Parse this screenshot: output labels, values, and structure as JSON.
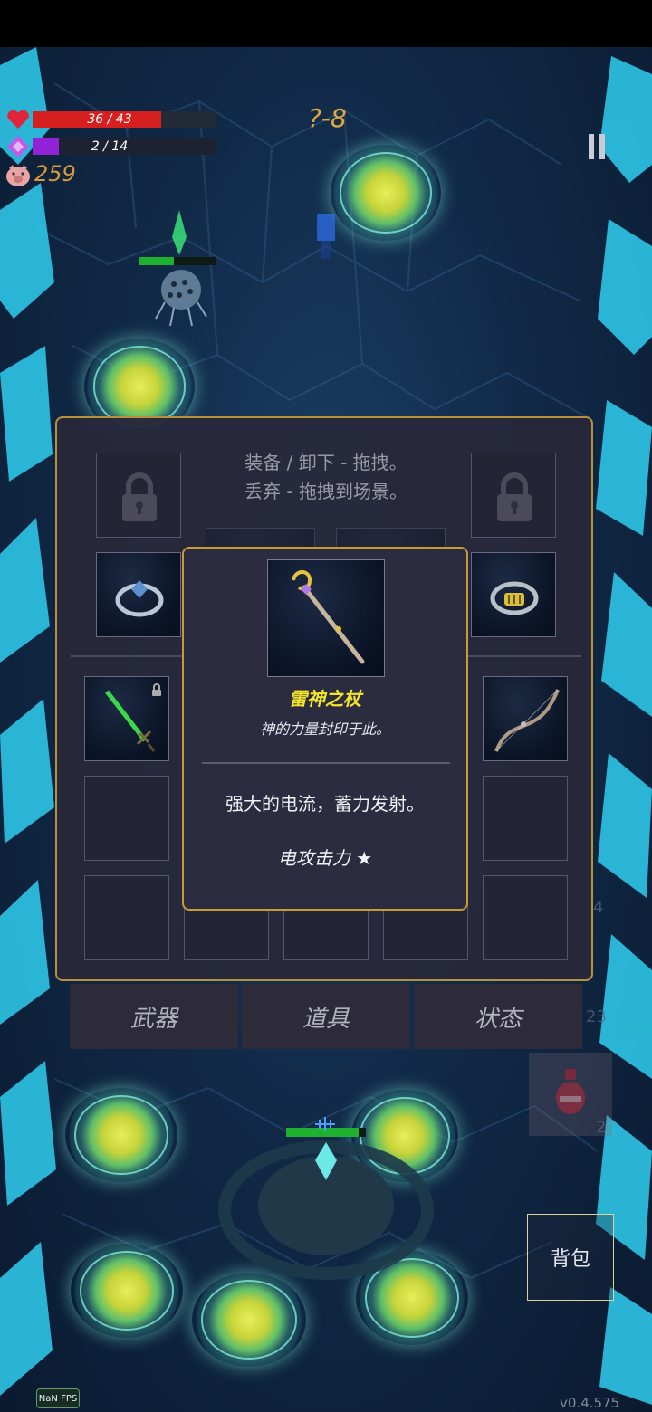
{
  "hud": {
    "hp_text": "36 / 43",
    "hp_fraction": 0.837,
    "mp_text": "2 / 14",
    "mp_fraction": 0.143,
    "coins": "259",
    "stage": "?-8"
  },
  "inventory": {
    "hint_line1": "装备 / 卸下 - 拖拽。",
    "hint_line2": "丢弃 - 拖拽到场景。",
    "tabs": [
      {
        "label": "武器"
      },
      {
        "label": "道具"
      },
      {
        "label": "状态"
      }
    ]
  },
  "tooltip": {
    "name": "雷神之杖",
    "description": "神的力量封印于此。",
    "effect": "强大的电流，蓄力发射。",
    "attribute": "电攻击力 ★"
  },
  "side_counts": {
    "a": "4",
    "b": "23",
    "c": "2"
  },
  "bag_label": "背包",
  "fps_label": "NaN FPS",
  "version": "v0.4.575",
  "colors": {
    "hp": "#d6201f",
    "mp": "#9222d8",
    "gold_text": "#e2a93a",
    "panel_border": "#b8913a",
    "item_name": "#f2e52a"
  }
}
